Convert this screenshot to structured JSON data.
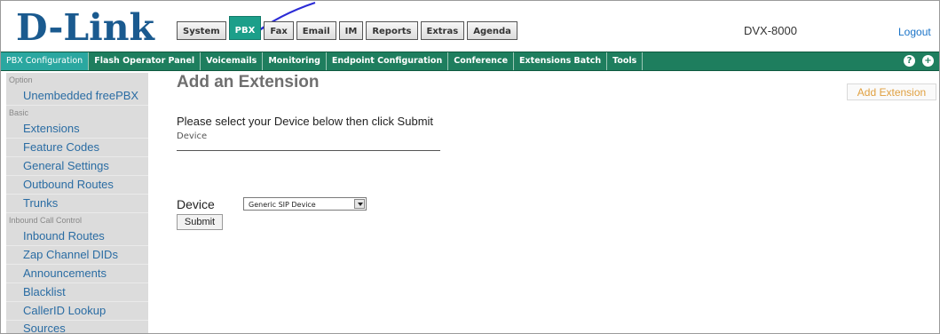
{
  "header": {
    "logo_text": "D-Link",
    "device_name": "DVX-8000",
    "logout_label": "Logout",
    "tabs": [
      {
        "label": "System",
        "active": false
      },
      {
        "label": "PBX",
        "active": true
      },
      {
        "label": "Fax",
        "active": false
      },
      {
        "label": "Email",
        "active": false
      },
      {
        "label": "IM",
        "active": false
      },
      {
        "label": "Reports",
        "active": false
      },
      {
        "label": "Extras",
        "active": false
      },
      {
        "label": "Agenda",
        "active": false
      }
    ]
  },
  "nav": {
    "items": [
      {
        "label": "PBX Configuration",
        "active": true
      },
      {
        "label": "Flash Operator Panel",
        "active": false
      },
      {
        "label": "Voicemails",
        "active": false
      },
      {
        "label": "Monitoring",
        "active": false
      },
      {
        "label": "Endpoint Configuration",
        "active": false
      },
      {
        "label": "Conference",
        "active": false
      },
      {
        "label": "Extensions Batch",
        "active": false
      },
      {
        "label": "Tools",
        "active": false
      }
    ],
    "help_icon": "?",
    "add_icon": "+"
  },
  "sidebar": {
    "sections": [
      {
        "title": "Option",
        "items": [
          "Unembedded freePBX"
        ]
      },
      {
        "title": "Basic",
        "items": [
          "Extensions",
          "Feature Codes",
          "General Settings",
          "Outbound Routes",
          "Trunks"
        ]
      },
      {
        "title": "Inbound Call Control",
        "items": [
          "Inbound Routes",
          "Zap Channel DIDs",
          "Announcements",
          "Blacklist",
          "CallerID Lookup Sources"
        ]
      }
    ]
  },
  "main": {
    "title": "Add an Extension",
    "instruction": "Please select your Device below then click Submit",
    "subhead": "Device",
    "device_label": "Device",
    "device_selected": "Generic SIP Device",
    "submit_label": "Submit",
    "add_extension_label": "Add Extension"
  },
  "colors": {
    "tab_active": "#1c9f8a",
    "nav_bar": "#1e7e5e",
    "nav_active": "#2aa7a0",
    "logo": "#1a5a8f",
    "link": "#1a73c7",
    "sidebar_link": "#2a6ca3",
    "annotation_arrow": "#2b2bd6"
  }
}
